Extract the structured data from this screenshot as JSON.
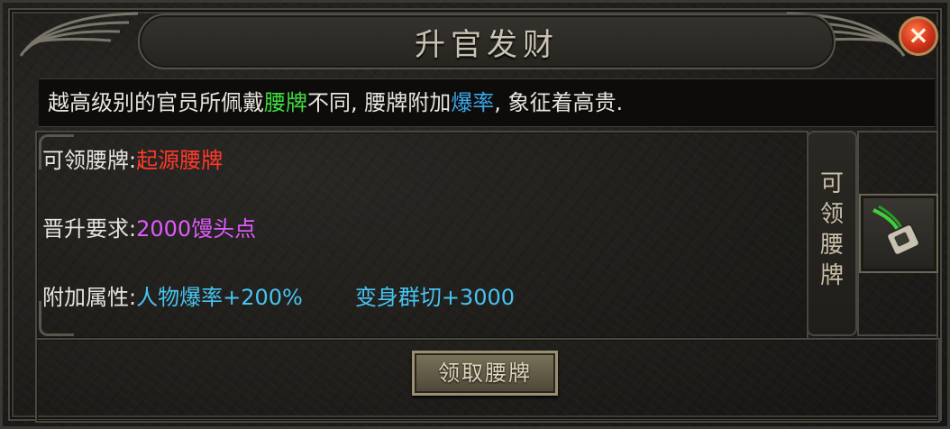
{
  "window": {
    "title": "升官发财",
    "close_symbol": "×"
  },
  "description": {
    "prefix": "越高级别的官员所佩戴",
    "highlight1": "腰牌",
    "middle": "不同, 腰牌附加",
    "highlight2": "爆率",
    "suffix": ", 象征着高贵."
  },
  "info": {
    "badge_label": "可领腰牌:",
    "badge_value": "起源腰牌",
    "requirement_label": "晋升要求:",
    "requirement_value": "2000馒头点",
    "attribute_label": "附加属性:",
    "attribute_value1": "人物爆率+200%",
    "attribute_value2": "变身群切+3000"
  },
  "side_panel": {
    "chars": [
      "可",
      "领",
      "腰",
      "牌"
    ],
    "item_icon": "waist-badge-icon"
  },
  "claim_button": {
    "label": "领取腰牌"
  },
  "colors": {
    "red": "#ff3a2a",
    "purple": "#e25aff",
    "cyan": "#47c3f0",
    "green": "#3fdc3f",
    "blue": "#3aa7e8"
  }
}
